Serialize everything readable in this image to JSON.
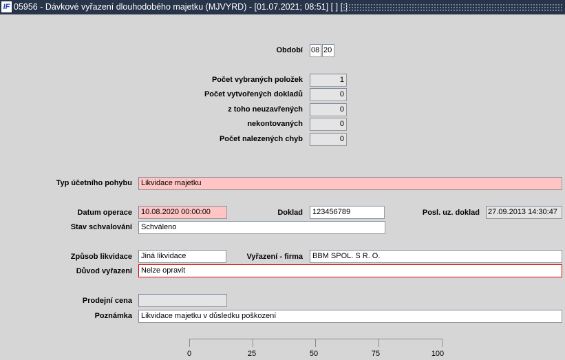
{
  "window": {
    "title": "05956 - Dávkové vyřazení dlouhodobého majetku (MJVYRD) - [01.07.2021; 08:51] [ ] [ ]",
    "logo": "IF"
  },
  "period": {
    "label": "Období",
    "month": "08",
    "year": "20"
  },
  "counts": [
    {
      "label": "Počet vybraných položek",
      "value": "1"
    },
    {
      "label": "Počet vytvořených dokladů",
      "value": "0"
    },
    {
      "label": "z toho  neuzavřených",
      "value": "0"
    },
    {
      "label": "nekontovaných",
      "value": "0"
    },
    {
      "label": "Počet nalezených chyb",
      "value": "0"
    }
  ],
  "form": {
    "typ": {
      "label": "Typ účetního pohybu",
      "value": "Likvidace majetku"
    },
    "datum": {
      "label": "Datum operace",
      "value": "10.08.2020 00:00:00"
    },
    "doklad": {
      "label": "Doklad",
      "value": "123456789"
    },
    "posl": {
      "label": "Posl. uz. doklad",
      "value": "27.09.2013 14:30:47"
    },
    "stav": {
      "label": "Stav schvalování",
      "value": "Schváleno"
    },
    "zpusob": {
      "label": "Způsob likvidace",
      "value": "Jiná likvidace"
    },
    "firma": {
      "label": "Vyřazení - firma",
      "value": "BBM SPOL. S R. O."
    },
    "duvod": {
      "label": "Důvod vyřazení",
      "value": "Nelze opravit"
    },
    "cena": {
      "label": "Prodejní cena",
      "value": ""
    },
    "poznamka": {
      "label": "Poznámka",
      "value": "Likvidace majetku v důsledku poškození"
    }
  },
  "progress": {
    "ticks": [
      "0",
      "25",
      "50",
      "75",
      "100"
    ],
    "value": 0
  },
  "colors": {
    "titlebar": "#27344a",
    "required": "#ffc4c4",
    "error": "#e00000"
  }
}
